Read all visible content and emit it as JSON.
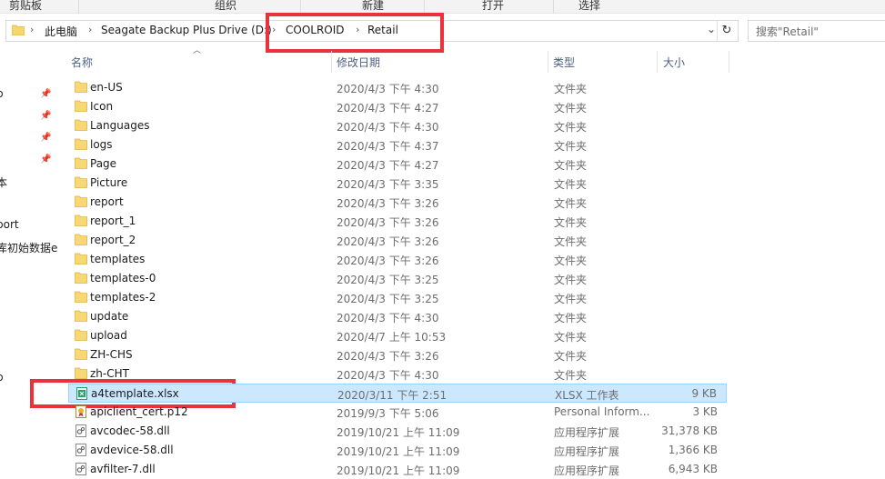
{
  "ribbon": {
    "items": [
      "剪贴板",
      "组织",
      "新建",
      "打开",
      "选择"
    ]
  },
  "address": {
    "crumbs": [
      "此电脑",
      "Seagate Backup Plus Drive (D:)",
      "COOLROID",
      "Retail"
    ]
  },
  "search": {
    "placeholder": "搜索\"Retail\""
  },
  "nav": {
    "items": [
      "p",
      "本",
      "port",
      "库初始数据e",
      "p"
    ]
  },
  "columns": {
    "name": "名称",
    "date": "修改日期",
    "type": "类型",
    "size": "大小"
  },
  "files": [
    {
      "name": "en-US",
      "date": "2020/4/3 下午 4:30",
      "type": "文件夹",
      "size": "",
      "icon": "folder-icon"
    },
    {
      "name": "Icon",
      "date": "2020/4/3 下午 4:27",
      "type": "文件夹",
      "size": "",
      "icon": "folder-icon"
    },
    {
      "name": "Languages",
      "date": "2020/4/3 下午 4:30",
      "type": "文件夹",
      "size": "",
      "icon": "folder-icon"
    },
    {
      "name": "logs",
      "date": "2020/4/3 下午 4:37",
      "type": "文件夹",
      "size": "",
      "icon": "folder-icon"
    },
    {
      "name": "Page",
      "date": "2020/4/3 下午 4:27",
      "type": "文件夹",
      "size": "",
      "icon": "folder-icon"
    },
    {
      "name": "Picture",
      "date": "2020/4/3 下午 3:35",
      "type": "文件夹",
      "size": "",
      "icon": "folder-icon"
    },
    {
      "name": "report",
      "date": "2020/4/3 下午 3:26",
      "type": "文件夹",
      "size": "",
      "icon": "folder-icon"
    },
    {
      "name": "report_1",
      "date": "2020/4/3 下午 3:26",
      "type": "文件夹",
      "size": "",
      "icon": "folder-icon"
    },
    {
      "name": "report_2",
      "date": "2020/4/3 下午 3:26",
      "type": "文件夹",
      "size": "",
      "icon": "folder-icon"
    },
    {
      "name": "templates",
      "date": "2020/4/3 下午 3:26",
      "type": "文件夹",
      "size": "",
      "icon": "folder-icon"
    },
    {
      "name": "templates-0",
      "date": "2020/4/3 下午 3:25",
      "type": "文件夹",
      "size": "",
      "icon": "folder-icon"
    },
    {
      "name": "templates-2",
      "date": "2020/4/3 下午 3:25",
      "type": "文件夹",
      "size": "",
      "icon": "folder-icon"
    },
    {
      "name": "update",
      "date": "2020/4/3 下午 4:30",
      "type": "文件夹",
      "size": "",
      "icon": "folder-icon"
    },
    {
      "name": "upload",
      "date": "2020/4/7 上午 10:53",
      "type": "文件夹",
      "size": "",
      "icon": "folder-icon"
    },
    {
      "name": "ZH-CHS",
      "date": "2020/4/3 下午 3:26",
      "type": "文件夹",
      "size": "",
      "icon": "folder-icon"
    },
    {
      "name": "zh-CHT",
      "date": "2020/4/3 下午 4:30",
      "type": "文件夹",
      "size": "",
      "icon": "folder-icon"
    },
    {
      "name": "a4template.xlsx",
      "date": "2020/3/11 下午 2:51",
      "type": "XLSX 工作表",
      "size": "9 KB",
      "icon": "excel-file-icon",
      "selected": true
    },
    {
      "name": "apiclient_cert.p12",
      "date": "2019/9/3 下午 5:06",
      "type": "Personal Inform...",
      "size": "3 KB",
      "icon": "certificate-file-icon"
    },
    {
      "name": "avcodec-58.dll",
      "date": "2019/10/21 上午 11:09",
      "type": "应用程序扩展",
      "size": "31,378 KB",
      "icon": "dll-file-icon"
    },
    {
      "name": "avdevice-58.dll",
      "date": "2019/10/21 上午 11:09",
      "type": "应用程序扩展",
      "size": "1,366 KB",
      "icon": "dll-file-icon"
    },
    {
      "name": "avfilter-7.dll",
      "date": "2019/10/21 上午 11:09",
      "type": "应用程序扩展",
      "size": "6,943 KB",
      "icon": "dll-file-icon"
    }
  ]
}
